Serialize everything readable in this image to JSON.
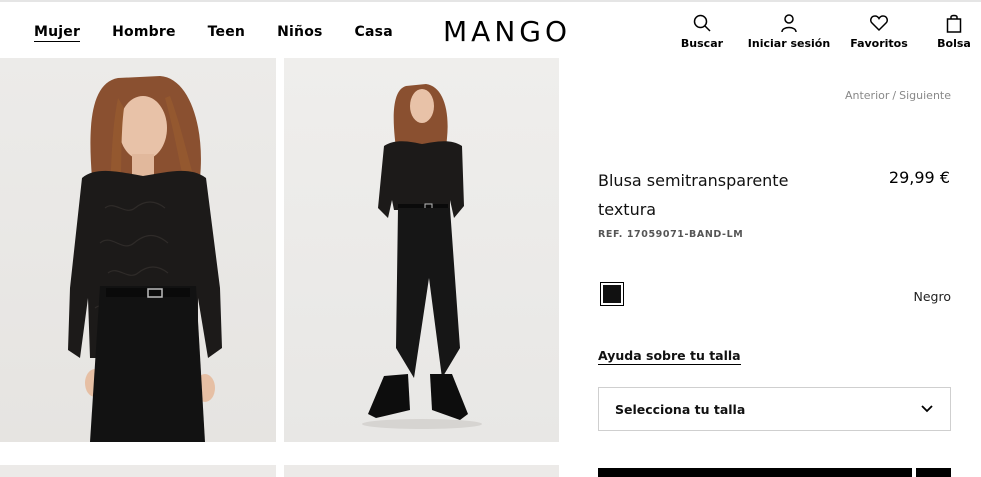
{
  "brand": {
    "logo": "MANGO"
  },
  "nav": {
    "items": [
      {
        "label": "Mujer",
        "active": true
      },
      {
        "label": "Hombre"
      },
      {
        "label": "Teen"
      },
      {
        "label": "Niños"
      },
      {
        "label": "Casa"
      }
    ]
  },
  "tools": {
    "search": {
      "label": "Buscar",
      "icon": "search-icon"
    },
    "account": {
      "label": "Iniciar sesión",
      "icon": "user-icon"
    },
    "favorites": {
      "label": "Favoritos",
      "icon": "heart-icon"
    },
    "bag": {
      "label": "Bolsa",
      "icon": "bag-icon"
    }
  },
  "breadcrumb": {
    "prev": "Anterior",
    "separator": "/",
    "next": "Siguiente"
  },
  "product": {
    "title": "Blusa semitransparente textura",
    "price": "29,99 €",
    "ref": "REF. 17059071-BAND-LM",
    "color": {
      "name": "Negro",
      "hex": "#111111"
    },
    "size_help": "Ayuda sobre tu talla",
    "size_select_placeholder": "Selecciona tu talla"
  },
  "colors": {
    "accent": "#000000",
    "border": "#cfcfcf",
    "muted": "#888888"
  }
}
